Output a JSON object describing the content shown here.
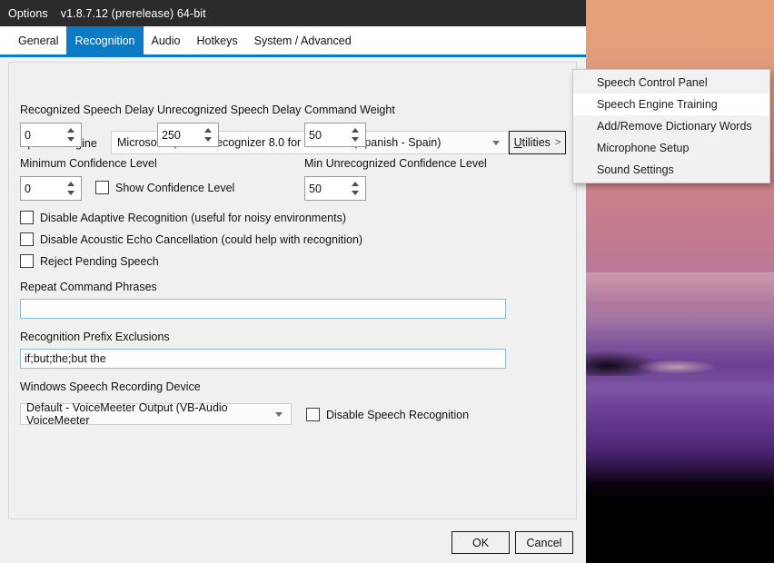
{
  "window": {
    "title": "Options",
    "version": "v1.8.7.12 (prerelease)  64-bit",
    "accent_color": "#0a7bc4",
    "titlebar_color": "#2b2b2b"
  },
  "tabs": [
    {
      "label": "General",
      "active": false
    },
    {
      "label": "Recognition",
      "active": true
    },
    {
      "label": "Audio",
      "active": false
    },
    {
      "label": "Hotkeys",
      "active": false
    },
    {
      "label": "System / Advanced",
      "active": false
    }
  ],
  "recognition": {
    "speech_engine_label": "Speech Engine",
    "speech_engine_value": "Microsoft Speech Recognizer 8.0 for Windows (Spanish - Spain)",
    "utilities_button": {
      "label": "Utilities",
      "accesskey": "U",
      "rest": "tilities",
      "chevron": ">"
    },
    "recognized_speech_delay_label": "Recognized Speech Delay",
    "recognized_speech_delay_value": "0",
    "unrecognized_speech_delay_label": "Unrecognized Speech Delay",
    "unrecognized_speech_delay_value": "250",
    "command_weight_label": "Command Weight",
    "command_weight_value": "50",
    "minimum_confidence_label": "Minimum Confidence Level",
    "minimum_confidence_value": "0",
    "show_confidence_label": "Show Confidence Level",
    "show_confidence_checked": false,
    "min_unrecognized_confidence_label": "Min Unrecognized Confidence Level",
    "min_unrecognized_confidence_value": "50",
    "disable_adaptive_label": "Disable Adaptive Recognition (useful for noisy environments)",
    "disable_adaptive_checked": false,
    "disable_echo_label": "Disable Acoustic Echo Cancellation (could help with recognition)",
    "disable_echo_checked": false,
    "reject_pending_label": "Reject Pending Speech",
    "reject_pending_checked": false,
    "repeat_command_label": "Repeat Command Phrases",
    "repeat_command_value": "",
    "repeat_command_placeholder": "",
    "prefix_exclusions_label": "Recognition Prefix Exclusions",
    "prefix_exclusions_value": "if;but;the;but the",
    "recording_device_label": "Windows Speech Recording Device",
    "recording_device_value": "Default - VoiceMeeter Output (VB-Audio VoiceMeeter",
    "disable_speech_recognition_label": "Disable Speech Recognition",
    "disable_speech_recognition_checked": false
  },
  "footer": {
    "ok_label": "OK",
    "cancel_label": "Cancel"
  },
  "utilities_menu": {
    "items": [
      {
        "label": "Speech Control Panel",
        "hover": false
      },
      {
        "label": "Speech Engine Training",
        "hover": true
      },
      {
        "label": "Add/Remove Dictionary Words",
        "hover": false
      },
      {
        "label": "Microphone Setup",
        "hover": false
      },
      {
        "label": "Sound Settings",
        "hover": false
      }
    ]
  }
}
